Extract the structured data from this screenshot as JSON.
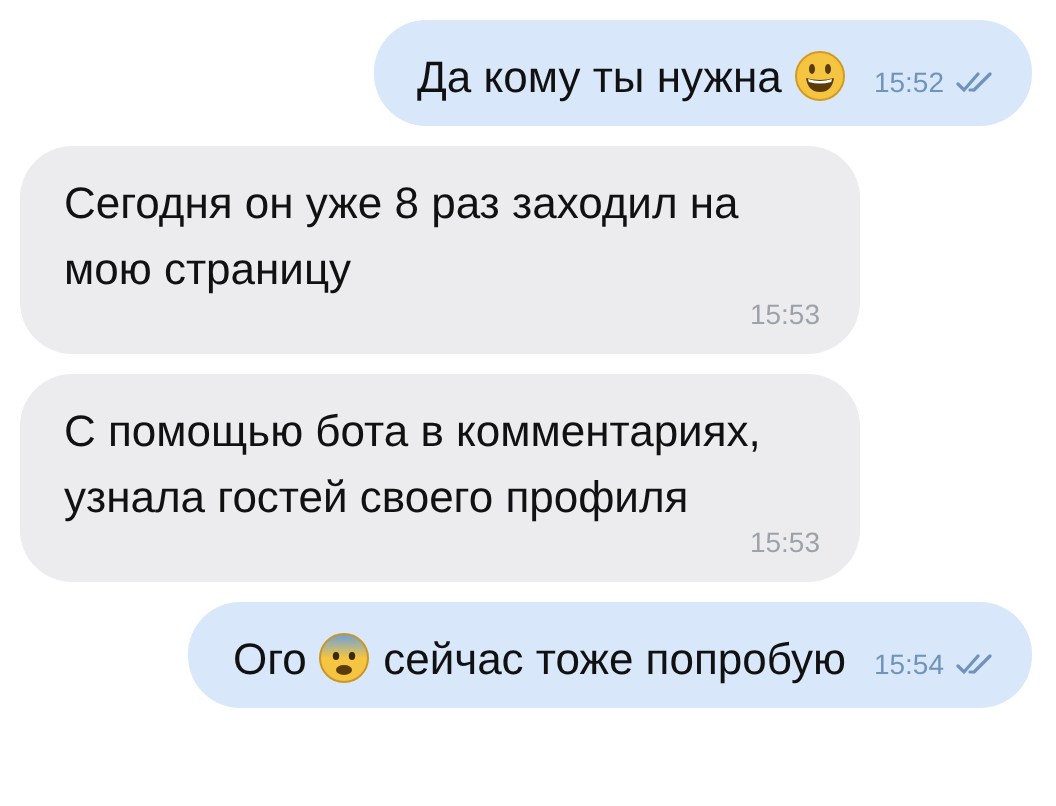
{
  "messages": [
    {
      "outgoing": true,
      "parts": [
        {
          "kind": "text",
          "text": "Да кому ты нужна "
        },
        {
          "kind": "emoji"
        }
      ],
      "time": "15:52",
      "read": true
    },
    {
      "outgoing": false,
      "parts": [
        {
          "kind": "text",
          "text": "Сегодня он уже 8 раз заходил на мою страницу"
        }
      ],
      "time": "15:53"
    },
    {
      "outgoing": false,
      "parts": [
        {
          "kind": "text",
          "text": "С помощью бота в комментариях, узнала гостей своего профиля"
        }
      ],
      "time": "15:53"
    },
    {
      "outgoing": true,
      "parts": [
        {
          "kind": "text",
          "text": "Ого "
        },
        {
          "kind": "emoji"
        },
        {
          "kind": "text",
          "text": " сейчас тоже попробую"
        }
      ],
      "time": "15:54",
      "read": true
    }
  ]
}
